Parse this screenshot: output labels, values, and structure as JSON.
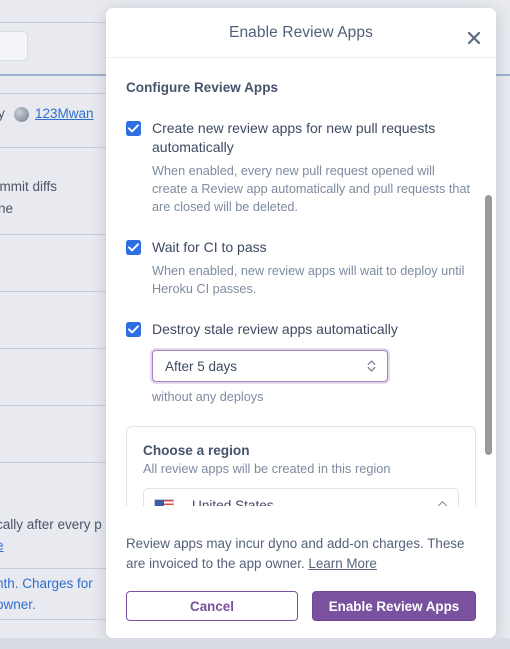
{
  "modal": {
    "title": "Enable Review Apps",
    "close_icon": "close-icon",
    "section_title": "Configure Review Apps",
    "options": [
      {
        "checked": true,
        "label": "Create new review apps for new pull requests automatically",
        "help": "When enabled, every new pull request opened will create a Review app automatically and pull requests that are closed will be deleted."
      },
      {
        "checked": true,
        "label": "Wait for CI to pass",
        "help": "When enabled, new review apps will wait to deploy until Heroku CI passes."
      },
      {
        "checked": true,
        "label": "Destroy stale review apps automatically",
        "help": ""
      }
    ],
    "stale_select": {
      "value": "After 5 days",
      "note": "without any deploys",
      "caret_icon": "chevron-updown-icon"
    },
    "region": {
      "title": "Choose a region",
      "subtitle": "All review apps will be created in this region",
      "selected": "United States",
      "flag_icon": "united-states-flag-icon",
      "caret_icon": "chevron-up-icon"
    },
    "footer": {
      "note": "Review apps may incur dyno and add-on charges. These are invoiced to the app owner.",
      "link": "Learn More",
      "cancel_label": "Cancel",
      "confirm_label": "Enable Review Apps"
    }
  },
  "background": {
    "author_prefix": "y",
    "author_link": "123Mwan",
    "commit_diffs": "ommit diffs",
    "line_word": "ne",
    "note_a": "cally after every p",
    "note_a_link": "e",
    "note_b": "nth. Charges for",
    "note_c": "owner."
  },
  "colors": {
    "accent_purple": "#79519e",
    "checkbox_blue": "#2f6fe4",
    "link_blue": "#2f6fd0",
    "text_dark": "#3d4a60",
    "text_muted": "#7d8ba0"
  }
}
